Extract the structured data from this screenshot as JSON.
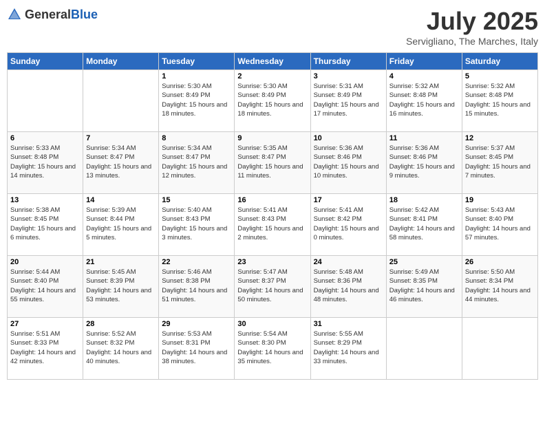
{
  "header": {
    "logo_general": "General",
    "logo_blue": "Blue",
    "month_title": "July 2025",
    "subtitle": "Servigliano, The Marches, Italy"
  },
  "days_of_week": [
    "Sunday",
    "Monday",
    "Tuesday",
    "Wednesday",
    "Thursday",
    "Friday",
    "Saturday"
  ],
  "weeks": [
    [
      {
        "day": "",
        "info": ""
      },
      {
        "day": "",
        "info": ""
      },
      {
        "day": "1",
        "info": "Sunrise: 5:30 AM\nSunset: 8:49 PM\nDaylight: 15 hours and 18 minutes."
      },
      {
        "day": "2",
        "info": "Sunrise: 5:30 AM\nSunset: 8:49 PM\nDaylight: 15 hours and 18 minutes."
      },
      {
        "day": "3",
        "info": "Sunrise: 5:31 AM\nSunset: 8:49 PM\nDaylight: 15 hours and 17 minutes."
      },
      {
        "day": "4",
        "info": "Sunrise: 5:32 AM\nSunset: 8:48 PM\nDaylight: 15 hours and 16 minutes."
      },
      {
        "day": "5",
        "info": "Sunrise: 5:32 AM\nSunset: 8:48 PM\nDaylight: 15 hours and 15 minutes."
      }
    ],
    [
      {
        "day": "6",
        "info": "Sunrise: 5:33 AM\nSunset: 8:48 PM\nDaylight: 15 hours and 14 minutes."
      },
      {
        "day": "7",
        "info": "Sunrise: 5:34 AM\nSunset: 8:47 PM\nDaylight: 15 hours and 13 minutes."
      },
      {
        "day": "8",
        "info": "Sunrise: 5:34 AM\nSunset: 8:47 PM\nDaylight: 15 hours and 12 minutes."
      },
      {
        "day": "9",
        "info": "Sunrise: 5:35 AM\nSunset: 8:47 PM\nDaylight: 15 hours and 11 minutes."
      },
      {
        "day": "10",
        "info": "Sunrise: 5:36 AM\nSunset: 8:46 PM\nDaylight: 15 hours and 10 minutes."
      },
      {
        "day": "11",
        "info": "Sunrise: 5:36 AM\nSunset: 8:46 PM\nDaylight: 15 hours and 9 minutes."
      },
      {
        "day": "12",
        "info": "Sunrise: 5:37 AM\nSunset: 8:45 PM\nDaylight: 15 hours and 7 minutes."
      }
    ],
    [
      {
        "day": "13",
        "info": "Sunrise: 5:38 AM\nSunset: 8:45 PM\nDaylight: 15 hours and 6 minutes."
      },
      {
        "day": "14",
        "info": "Sunrise: 5:39 AM\nSunset: 8:44 PM\nDaylight: 15 hours and 5 minutes."
      },
      {
        "day": "15",
        "info": "Sunrise: 5:40 AM\nSunset: 8:43 PM\nDaylight: 15 hours and 3 minutes."
      },
      {
        "day": "16",
        "info": "Sunrise: 5:41 AM\nSunset: 8:43 PM\nDaylight: 15 hours and 2 minutes."
      },
      {
        "day": "17",
        "info": "Sunrise: 5:41 AM\nSunset: 8:42 PM\nDaylight: 15 hours and 0 minutes."
      },
      {
        "day": "18",
        "info": "Sunrise: 5:42 AM\nSunset: 8:41 PM\nDaylight: 14 hours and 58 minutes."
      },
      {
        "day": "19",
        "info": "Sunrise: 5:43 AM\nSunset: 8:40 PM\nDaylight: 14 hours and 57 minutes."
      }
    ],
    [
      {
        "day": "20",
        "info": "Sunrise: 5:44 AM\nSunset: 8:40 PM\nDaylight: 14 hours and 55 minutes."
      },
      {
        "day": "21",
        "info": "Sunrise: 5:45 AM\nSunset: 8:39 PM\nDaylight: 14 hours and 53 minutes."
      },
      {
        "day": "22",
        "info": "Sunrise: 5:46 AM\nSunset: 8:38 PM\nDaylight: 14 hours and 51 minutes."
      },
      {
        "day": "23",
        "info": "Sunrise: 5:47 AM\nSunset: 8:37 PM\nDaylight: 14 hours and 50 minutes."
      },
      {
        "day": "24",
        "info": "Sunrise: 5:48 AM\nSunset: 8:36 PM\nDaylight: 14 hours and 48 minutes."
      },
      {
        "day": "25",
        "info": "Sunrise: 5:49 AM\nSunset: 8:35 PM\nDaylight: 14 hours and 46 minutes."
      },
      {
        "day": "26",
        "info": "Sunrise: 5:50 AM\nSunset: 8:34 PM\nDaylight: 14 hours and 44 minutes."
      }
    ],
    [
      {
        "day": "27",
        "info": "Sunrise: 5:51 AM\nSunset: 8:33 PM\nDaylight: 14 hours and 42 minutes."
      },
      {
        "day": "28",
        "info": "Sunrise: 5:52 AM\nSunset: 8:32 PM\nDaylight: 14 hours and 40 minutes."
      },
      {
        "day": "29",
        "info": "Sunrise: 5:53 AM\nSunset: 8:31 PM\nDaylight: 14 hours and 38 minutes."
      },
      {
        "day": "30",
        "info": "Sunrise: 5:54 AM\nSunset: 8:30 PM\nDaylight: 14 hours and 35 minutes."
      },
      {
        "day": "31",
        "info": "Sunrise: 5:55 AM\nSunset: 8:29 PM\nDaylight: 14 hours and 33 minutes."
      },
      {
        "day": "",
        "info": ""
      },
      {
        "day": "",
        "info": ""
      }
    ]
  ]
}
